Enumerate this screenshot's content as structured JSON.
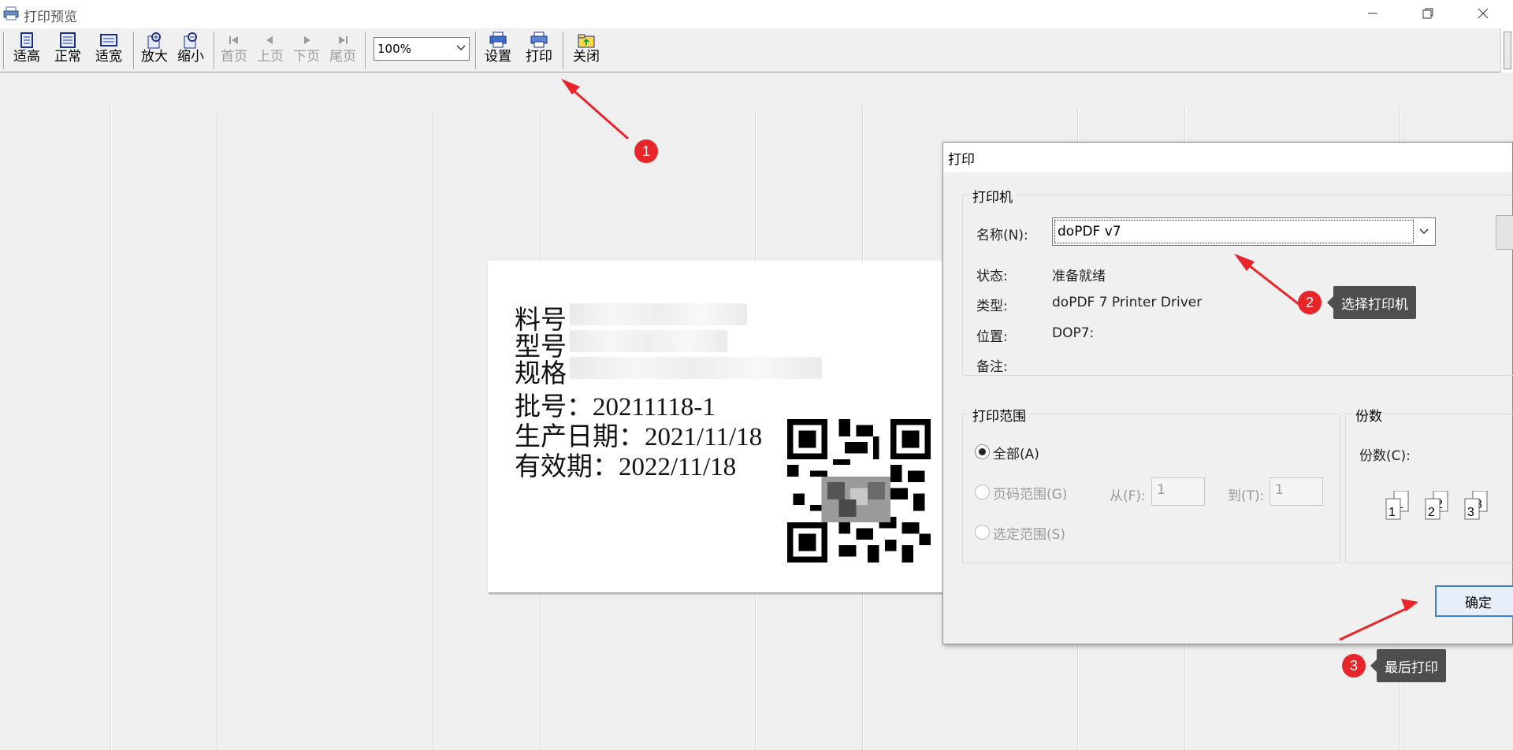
{
  "window": {
    "title": "打印预览",
    "minimize_icon": "minimize-icon",
    "restore_icon": "restore-icon",
    "close_icon": "close-icon"
  },
  "toolbar": {
    "fit_height": "适高",
    "normal": "正常",
    "fit_width": "适宽",
    "zoom_in": "放大",
    "zoom_out": "缩小",
    "first_page": "首页",
    "prev_page": "上页",
    "next_page": "下页",
    "last_page": "尾页",
    "zoom_value": "100%",
    "setup": "设置",
    "print": "打印",
    "close": "关闭"
  },
  "label": {
    "material_no": "料号",
    "model": "型号",
    "spec": "规格",
    "batch": "批号：20211118-1",
    "production_date": "生产日期：2021/11/18",
    "expiry_date": "有效期：2022/11/18"
  },
  "print_dialog": {
    "title": "打印",
    "printer_group": "打印机",
    "name_label": "名称(N):",
    "name_value": "doPDF v7",
    "status_label": "状态:",
    "status_value": "准备就绪",
    "type_label": "类型:",
    "type_value": "doPDF 7 Printer Driver",
    "location_label": "位置:",
    "location_value": "DOP7:",
    "comment_label": "备注:",
    "range_group": "打印范围",
    "range_all": "全部(A)",
    "range_pages": "页码范围(G)",
    "from_label": "从(F):",
    "from_value": "1",
    "to_label": "到(T):",
    "to_value": "1",
    "range_selection": "选定范围(S)",
    "copies_group": "份数",
    "copies_label": "份数(C):",
    "ok_button": "确定"
  },
  "annotations": {
    "step1": "1",
    "step2": "2",
    "step2_text": "选择打印机",
    "step3": "3",
    "step3_text": "最后打印",
    "accent": "#e8262a"
  }
}
